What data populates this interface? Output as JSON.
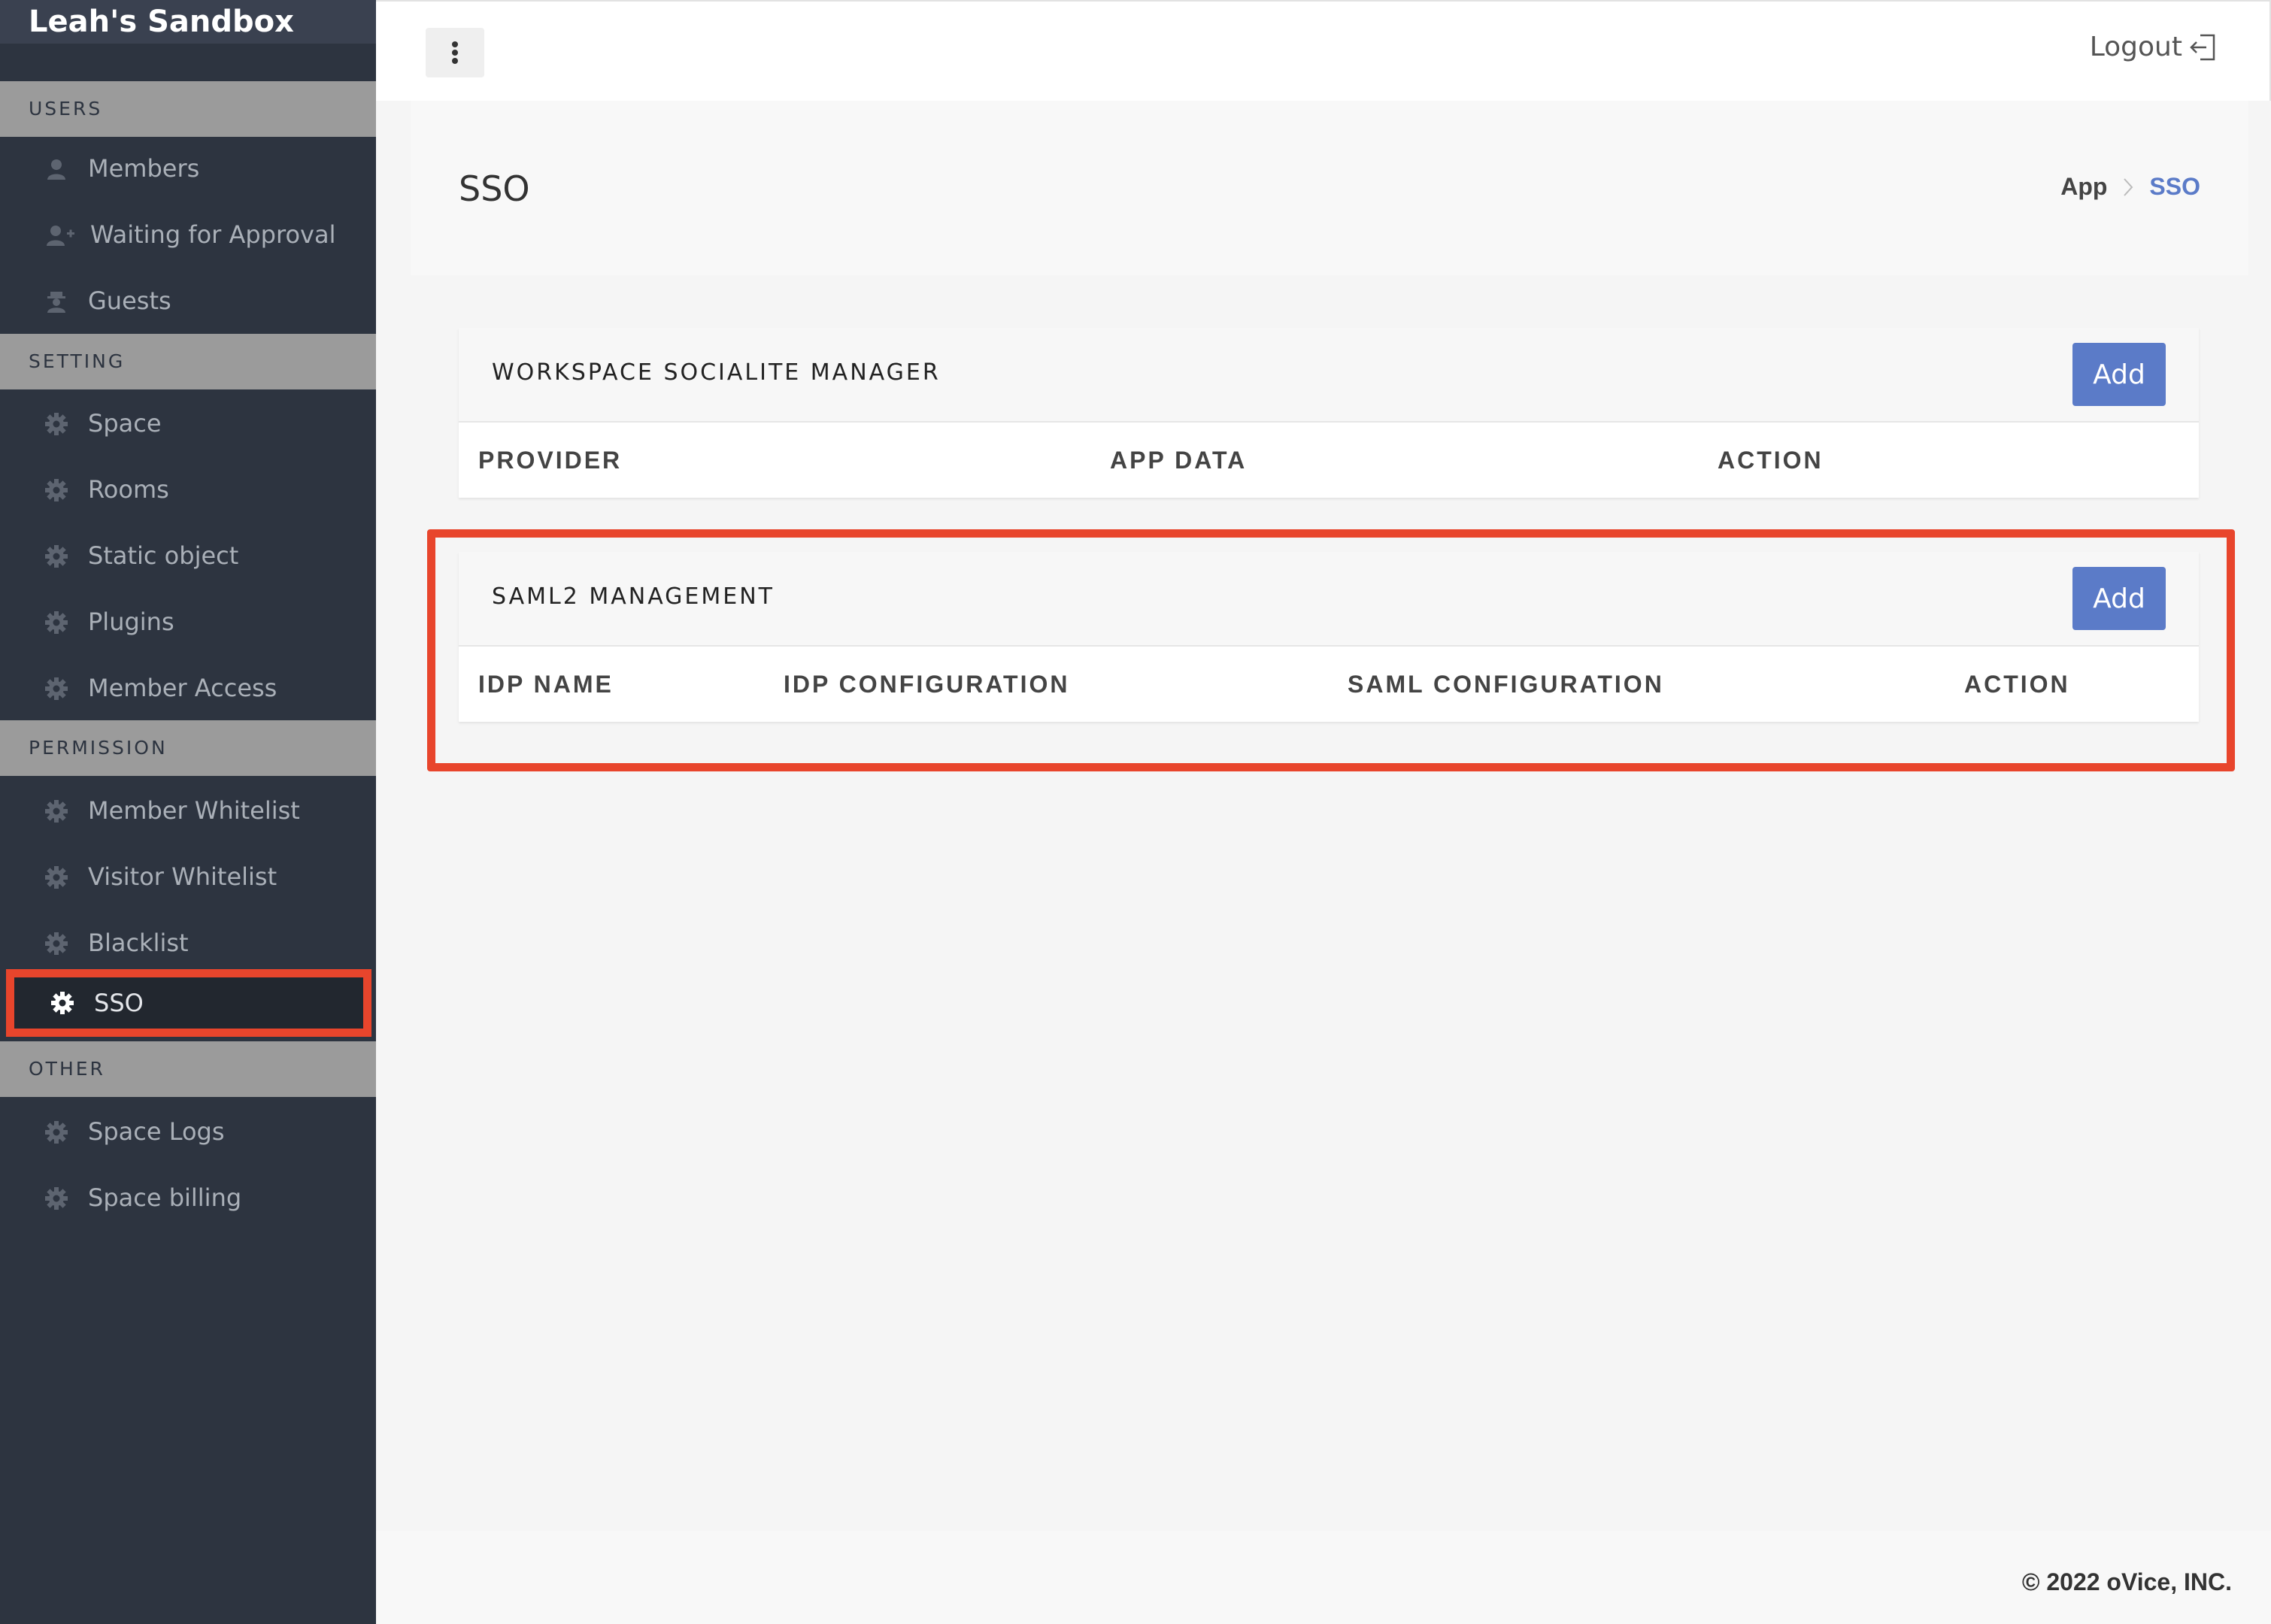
{
  "sidebar": {
    "brand": "Leah's Sandbox",
    "sections": {
      "users": "USERS",
      "setting": "SETTING",
      "permission": "PERMISSION",
      "other": "OTHER"
    },
    "items": {
      "members": {
        "label": "Members",
        "icon": "user-icon"
      },
      "waiting": {
        "label": "Waiting for Approval",
        "icon": "user-plus-icon"
      },
      "guests": {
        "label": "Guests",
        "icon": "guest-icon"
      },
      "space": {
        "label": "Space",
        "icon": "gear-icon"
      },
      "rooms": {
        "label": "Rooms",
        "icon": "gear-icon"
      },
      "static_object": {
        "label": "Static object",
        "icon": "gear-icon"
      },
      "plugins": {
        "label": "Plugins",
        "icon": "gear-icon"
      },
      "member_access": {
        "label": "Member Access",
        "icon": "gear-icon"
      },
      "member_whitelist": {
        "label": "Member Whitelist",
        "icon": "gear-icon"
      },
      "visitor_whitelist": {
        "label": "Visitor Whitelist",
        "icon": "gear-icon"
      },
      "blacklist": {
        "label": "Blacklist",
        "icon": "gear-icon"
      },
      "sso": {
        "label": "SSO",
        "icon": "gear-icon",
        "active": true
      },
      "space_logs": {
        "label": "Space Logs",
        "icon": "gear-icon"
      },
      "space_billing": {
        "label": "Space billing",
        "icon": "gear-icon"
      }
    }
  },
  "topbar": {
    "logout_label": "Logout"
  },
  "page": {
    "title": "SSO",
    "breadcrumb": [
      "App",
      "SSO"
    ]
  },
  "socialite_panel": {
    "title": "WORKSPACE SOCIALITE MANAGER",
    "add_label": "Add",
    "columns": [
      "PROVIDER",
      "APP DATA",
      "ACTION"
    ],
    "rows": []
  },
  "saml_panel": {
    "title": "SAML2 MANAGEMENT",
    "add_label": "Add",
    "columns": [
      "IDP NAME",
      "IDP CONFIGURATION",
      "SAML CONFIGURATION",
      "ACTION"
    ],
    "rows": []
  },
  "footer": {
    "copyright": "© 2022 oVice, INC."
  },
  "colors": {
    "sidebar_bg": "#2d3440",
    "section_bg": "#9b9b9b",
    "accent": "#5b7bc8",
    "highlight": "#e8452c"
  }
}
